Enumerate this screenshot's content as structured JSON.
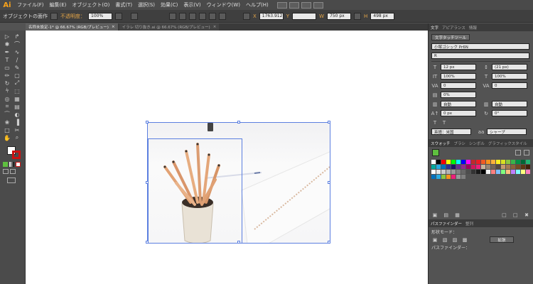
{
  "app": {
    "logo": "Ai"
  },
  "menu": [
    "ファイル(F)",
    "編集(E)",
    "オブジェクト(O)",
    "書式(T)",
    "選択(S)",
    "効果(C)",
    "表示(V)",
    "ウィンドウ(W)",
    "ヘルプ(H)"
  ],
  "control": {
    "object_label": "オブジェクトの面作",
    "opacity_label": "不透明度：",
    "opacity_value": "100%",
    "x_label": "X",
    "x_value": "1763.912",
    "y_label": "Y",
    "w_label": "W",
    "w_value": "750 px",
    "h_label": "H",
    "h_value": "498 px"
  },
  "doc_tabs": [
    {
      "label": "名称未設定-1* @ 66.67% (RGB/プレビュー)",
      "close": "×"
    },
    {
      "label": "イラレ 切り抜き.ai @ 66.67% (RGB/プレビュー)",
      "close": "×"
    }
  ],
  "panel": {
    "tabs": [
      "文字",
      "アピアランス",
      "情報"
    ],
    "touch_type_button": "文字タッチツール",
    "font_family": "小塚ゴシック Pr6N",
    "font_style": "R",
    "font_size": "12 px",
    "leading": "(21 px)",
    "vscale": "100%",
    "hscale": "100%",
    "kerning": "0",
    "tracking": "0",
    "tsume": "0%",
    "mojiaki_left": "自動",
    "mojiaki_right": "自動",
    "baseline": "0 px",
    "rotation": "0°",
    "language": "英語：米国",
    "antialias": "シャープ",
    "swatch_tabs": [
      "スウォッチ",
      "ブラシ",
      "シンボル",
      "グラフィックスタイル"
    ],
    "pathfinder_tabs": [
      "パスファインダー",
      "整列"
    ],
    "shape_mode_label": "形状モード：",
    "expand_button": "拡張",
    "pathfinder_label": "パスファインダー："
  },
  "colors": {
    "accent_orange": "#e3a447",
    "selection_blue": "#5b7fe0"
  },
  "swatches": [
    "#ffffff",
    "#000000",
    "#ff0000",
    "#ffff00",
    "#00ff00",
    "#00ffff",
    "#0000ff",
    "#ff00ff",
    "#c1272d",
    "#ed1c24",
    "#f15a24",
    "#f7931e",
    "#fbb03b",
    "#fcee21",
    "#d9e021",
    "#8cc63f",
    "#39b54a",
    "#009245",
    "#006837",
    "#22b573",
    "#00a99d",
    "#29abe2",
    "#0071bc",
    "#2e3192",
    "#1b1464",
    "#662d91",
    "#93278f",
    "#9e005d",
    "#d4145a",
    "#ed1e79",
    "#c7b299",
    "#998675",
    "#736357",
    "#534741",
    "#c69c6d",
    "#a67c52",
    "#8c6239",
    "#754c24",
    "#603813",
    "#42210b",
    "#ffffff",
    "#e6e6e6",
    "#cccccc",
    "#b3b3b3",
    "#999999",
    "#808080",
    "#666666",
    "#4d4d4d",
    "#333333",
    "#1a1a1a",
    "#000000",
    "#f2f2f2",
    "#ff7f7f",
    "#7fbfff",
    "#7fff7f",
    "#ffbf7f",
    "#bf7fff",
    "#7fffff",
    "#ffff7f",
    "#ff7fbf",
    "#0071bc",
    "#29abe2",
    "#8cc63f",
    "#f7931e",
    "#ed1e79",
    "#999999",
    "#808080"
  ]
}
